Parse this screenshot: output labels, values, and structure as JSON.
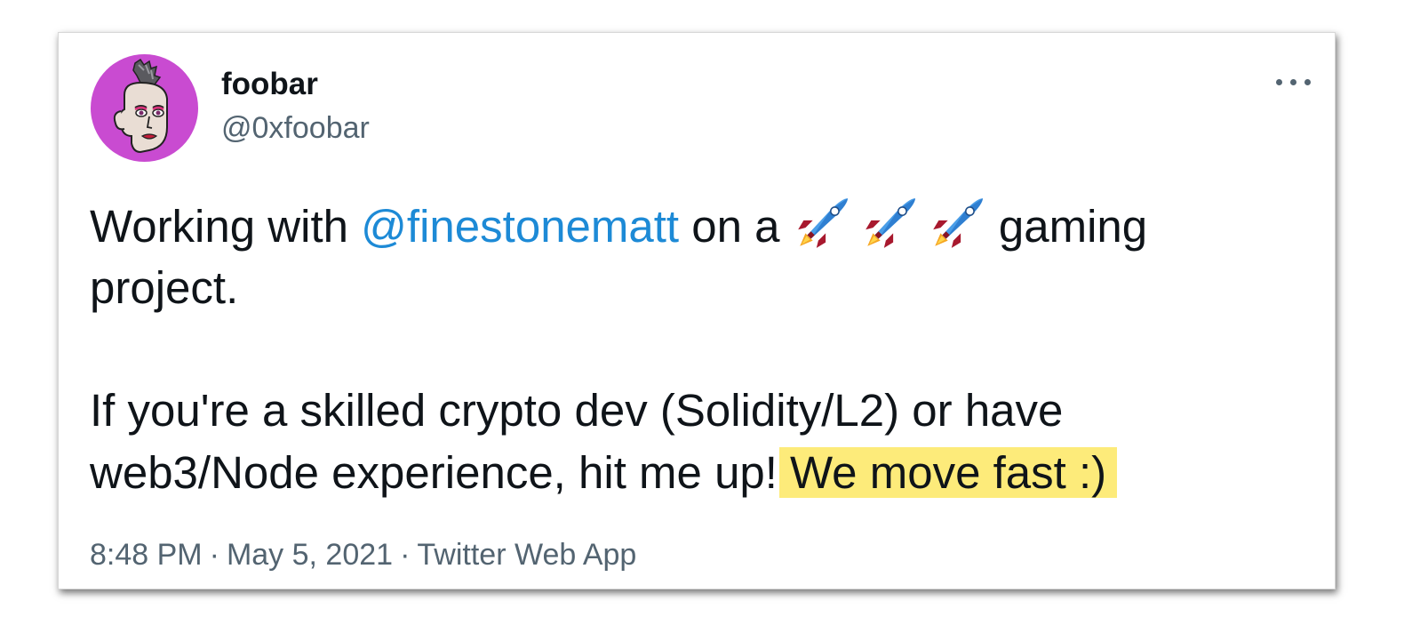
{
  "author": {
    "display_name": "foobar",
    "handle": "@0xfoobar",
    "avatar_icon": "punk-avatar-icon"
  },
  "menu": {
    "icon": "more-options-icon"
  },
  "tweet": {
    "line1_prefix": "Working with ",
    "mention": "@finestonematt",
    "line1_mid": " on a ",
    "emoji": [
      "rocket-emoji",
      "rocket-emoji",
      "rocket-emoji"
    ],
    "line1_suffix": " gaming",
    "line2": "project.",
    "line3": "If you're a skilled crypto dev (Solidity/L2) or have",
    "line4_prefix": "web3/Node experience, hit me up!",
    "highlighted": "We move fast :)"
  },
  "meta": {
    "time": "8:48 PM",
    "separator": "·",
    "date": "May 5, 2021",
    "source": "Twitter Web App"
  },
  "colors": {
    "mention": "#1d8ad6",
    "highlight": "#fdeb7a",
    "secondary_text": "#536471",
    "avatar_background": "#c94bd1"
  }
}
